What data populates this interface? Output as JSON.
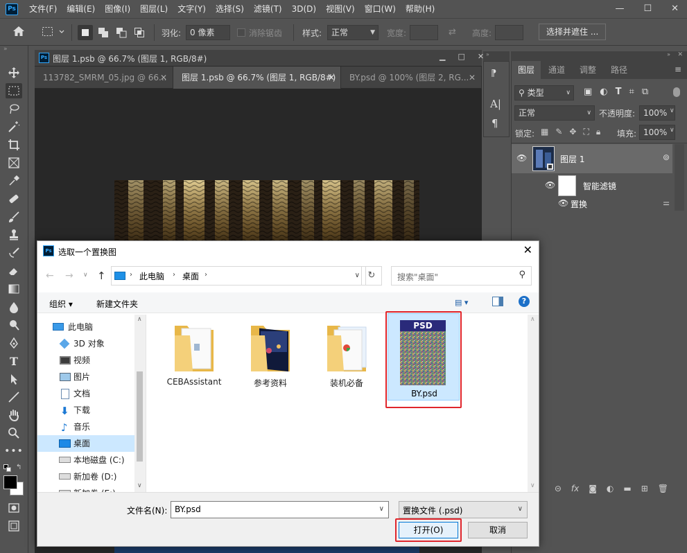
{
  "app": {
    "logo": "Ps"
  },
  "menubar": [
    "文件(F)",
    "编辑(E)",
    "图像(I)",
    "图层(L)",
    "文字(Y)",
    "选择(S)",
    "滤镜(T)",
    "3D(D)",
    "视图(V)",
    "窗口(W)",
    "帮助(H)"
  ],
  "options": {
    "feather_label": "羽化:",
    "feather_value": "0 像素",
    "antialias_label": "消除锯齿",
    "style_label": "样式:",
    "style_value": "正常",
    "width_label": "宽度:",
    "height_label": "高度:",
    "select_mask_button": "选择并遮住 ..."
  },
  "document": {
    "window_title": "图层 1.psb @ 66.7% (图层 1, RGB/8#)",
    "tabs": [
      {
        "label": "113782_SMRM_05.jpg @ 66..."
      },
      {
        "label": "图层 1.psb @ 66.7% (图层 1, RGB/8#)"
      },
      {
        "label": "BY.psd @ 100% (图层 2, RG..."
      }
    ]
  },
  "layers_panel": {
    "tabs": [
      "图层",
      "通道",
      "调整",
      "路径"
    ],
    "filter_kind": "类型",
    "blend_mode": "正常",
    "opacity_label": "不透明度:",
    "opacity_value": "100%",
    "lock_label": "锁定:",
    "fill_label": "填充:",
    "fill_value": "100%",
    "layers": [
      {
        "name": "图层 1"
      },
      {
        "name": "智能滤镜"
      },
      {
        "name": "置换"
      }
    ]
  },
  "dialog": {
    "title": "选取一个置换图",
    "breadcrumb": [
      "此电脑",
      "桌面"
    ],
    "search_placeholder": "搜索\"桌面\"",
    "toolbar": {
      "organize": "组织",
      "new_folder": "新建文件夹"
    },
    "nav": [
      {
        "label": "此电脑",
        "icon": "computer-icon"
      },
      {
        "label": "3D 对象",
        "icon": "cube-icon"
      },
      {
        "label": "视频",
        "icon": "video-icon"
      },
      {
        "label": "图片",
        "icon": "picture-icon"
      },
      {
        "label": "文档",
        "icon": "document-icon"
      },
      {
        "label": "下载",
        "icon": "download-icon"
      },
      {
        "label": "音乐",
        "icon": "music-icon"
      },
      {
        "label": "桌面",
        "icon": "desktop-icon"
      },
      {
        "label": "本地磁盘 (C:)",
        "icon": "drive-icon"
      },
      {
        "label": "新加卷 (D:)",
        "icon": "drive-icon"
      },
      {
        "label": "新加卷 (E:)",
        "icon": "drive-icon"
      }
    ],
    "files": [
      {
        "name": "CEBAssistant",
        "type": "folder"
      },
      {
        "name": "参考资料",
        "type": "folder"
      },
      {
        "name": "装机必备",
        "type": "folder"
      },
      {
        "name": "BY.psd",
        "type": "psd",
        "badge": "PSD"
      }
    ],
    "filename_label": "文件名(N):",
    "filename_value": "BY.psd",
    "filetype_value": "置换文件 (.psd)",
    "open_button": "打开(O)",
    "cancel_button": "取消"
  },
  "colors": {
    "accent_blue": "#0078d7",
    "highlight_red": "#e0252b",
    "ps_blue": "#31a8ff"
  }
}
